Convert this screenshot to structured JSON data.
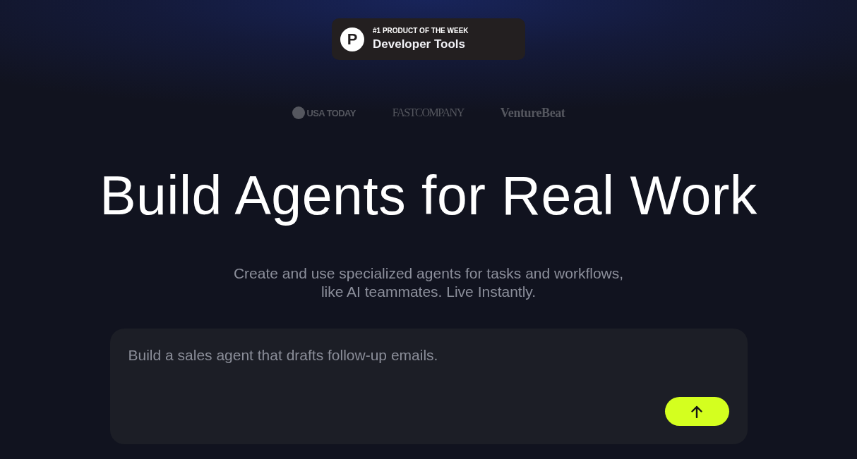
{
  "badge": {
    "logo_letter": "P",
    "eyebrow": "#1 PRODUCT OF THE WEEK",
    "title": "Developer Tools"
  },
  "press_logos": [
    {
      "kind": "dot_wordmark",
      "text": "USA TODAY"
    },
    {
      "kind": "serif_wordmark",
      "text": "FASTCOMPANY"
    },
    {
      "kind": "bold_serif_wordmark",
      "text": "VentureBeat"
    }
  ],
  "hero": {
    "title": "Build Agents for Real Work",
    "subtitle": "Create and use specialized agents for tasks and workflows, like AI teammates. Live Instantly."
  },
  "prompt": {
    "placeholder": "Build a sales agent that drafts follow-up emails."
  }
}
